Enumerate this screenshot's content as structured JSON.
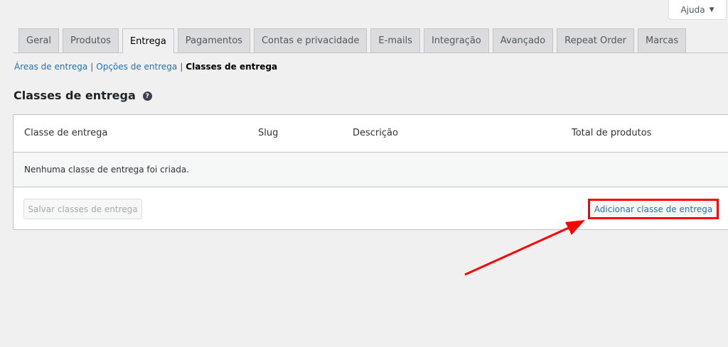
{
  "help": {
    "label": "Ajuda",
    "chevron": "▼"
  },
  "tabs": [
    {
      "label": "Geral"
    },
    {
      "label": "Produtos"
    },
    {
      "label": "Entrega",
      "active": true
    },
    {
      "label": "Pagamentos"
    },
    {
      "label": "Contas e privacidade"
    },
    {
      "label": "E-mails"
    },
    {
      "label": "Integração"
    },
    {
      "label": "Avançado"
    },
    {
      "label": "Repeat Order"
    },
    {
      "label": "Marcas"
    }
  ],
  "subsub": {
    "areas": "Áreas de entrega",
    "sep1": "|",
    "opcoes": "Opções de entrega",
    "sep2": "|",
    "classes": "Classes de entrega"
  },
  "page": {
    "title": "Classes de entrega",
    "help_icon": "?"
  },
  "table": {
    "columns": [
      "Classe de entrega",
      "Slug",
      "Descrição",
      "Total de produtos"
    ],
    "empty_message": "Nenhuma classe de entrega foi criada.",
    "save_button": "Salvar classes de entrega",
    "add_button": "Adicionar classe de entrega"
  },
  "colors": {
    "accent": "#2271b1",
    "highlight": "#ff0000"
  }
}
